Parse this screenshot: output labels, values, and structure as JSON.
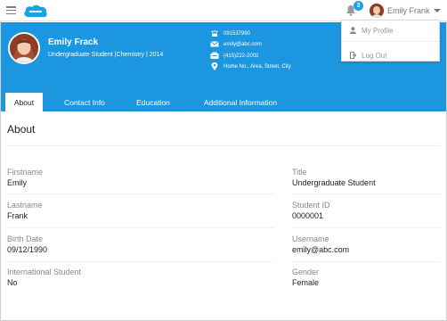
{
  "topbar": {
    "notification_count": "3",
    "user_name": "Emily Frank"
  },
  "dropdown": {
    "items": [
      {
        "label": "My Profile",
        "icon": "person-icon"
      },
      {
        "label": "Log Out",
        "icon": "logout-icon"
      }
    ]
  },
  "profile": {
    "name": "Emily Frack",
    "subtitle": "Undergraduate Student |Chemistry | 2014",
    "phone": "091537990",
    "email": "emily@abc.com",
    "fax": "(415)222-2002",
    "address": "Home No., Area, Street, City"
  },
  "tabs": [
    {
      "label": "About",
      "active": true
    },
    {
      "label": "Contact Info",
      "active": false
    },
    {
      "label": "Education",
      "active": false
    },
    {
      "label": "Additional Information",
      "active": false
    }
  ],
  "about": {
    "title": "About",
    "left": [
      {
        "label": "Firstname",
        "value": "Emily"
      },
      {
        "label": "Lastname",
        "value": "Frank"
      },
      {
        "label": "Birth Date",
        "value": "09/12/1990"
      },
      {
        "label": "International Student",
        "value": "No"
      }
    ],
    "right": [
      {
        "label": "Title",
        "value": "Undergraduate Student"
      },
      {
        "label": "Student ID",
        "value": "0000001"
      },
      {
        "label": "Username",
        "value": "emily@abc.com"
      },
      {
        "label": "Gender",
        "value": "Female"
      }
    ]
  },
  "colors": {
    "brand_blue": "#1b96df",
    "badge_blue": "#1aa3df"
  }
}
